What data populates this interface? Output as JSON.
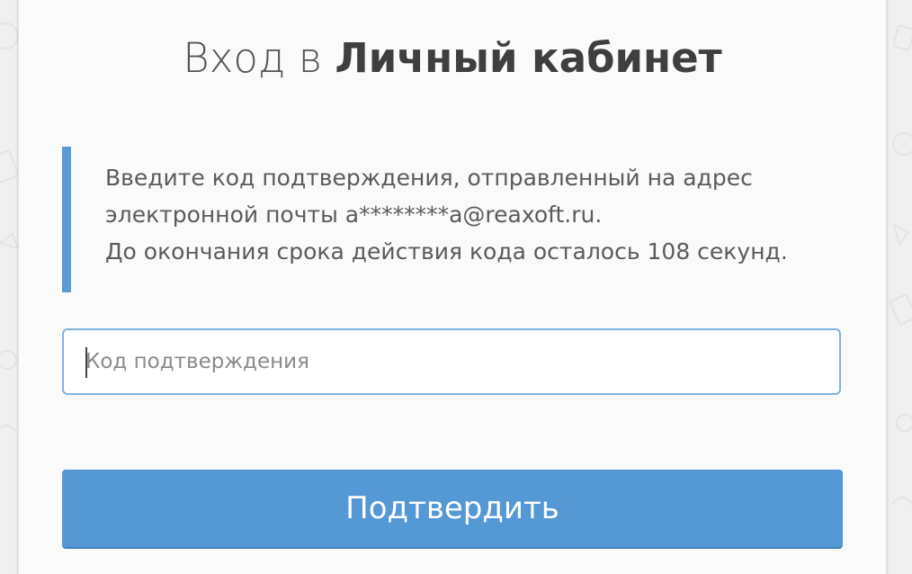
{
  "login": {
    "title_prefix": "Вход в",
    "title_emphasis": "Личный кабинет",
    "notice_line1": "Введите код подтверждения, отправленный на адрес",
    "notice_line2": "электронной почты a********a@reaxoft.ru.",
    "notice_line3": "До окончания срока действия кода осталось 108 секунд.",
    "code_placeholder": "Код подтверждения",
    "code_value": "",
    "submit_label": "Подтвердить"
  },
  "colors": {
    "accent": "#5498d5",
    "notice_bar": "#5a9bd6",
    "input_border": "#7fb2df",
    "card_bg": "#fafafa",
    "page_bg": "#efefef"
  }
}
